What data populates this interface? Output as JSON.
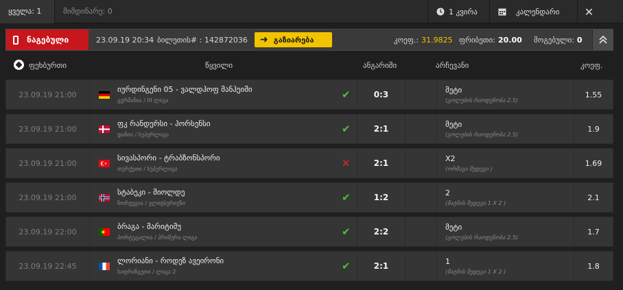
{
  "tabs": {
    "all_label": "ყველა: 1",
    "selected_label": "მიმდინარე: 0"
  },
  "top_actions": {
    "week_label": "1 კვირა",
    "calendar_label": "კალენდარი",
    "close_symbol": "✕"
  },
  "ticket": {
    "saved_label": "ნაგებული",
    "datetime": "23.09.19 20:34",
    "ticket_label": "ბილეთის# : 142872036",
    "share_label": "გაზიარება",
    "coef_label": "კოეფ.:",
    "coef_value": "31.9825",
    "freebet_label": "ფრიბეთი:",
    "freebet_value": "20.00",
    "winnings_label": "მოგებული:",
    "winnings_value": "0"
  },
  "table_header": {
    "sport": "ფეხბურთი",
    "event": "წყვილი",
    "score": "ანგარიში",
    "pick": "არჩევანი",
    "odds": "კოეფ."
  },
  "colors": {
    "accent": "#f2c300",
    "saved_red": "#c8161d",
    "win": "#4fbf3a",
    "lose": "#e12525"
  },
  "rows": [
    {
      "date": "23.09.19 21:00",
      "flag": "germany",
      "name": "იურდინგენი 05 - ვალდჰოფ მანჰეიმი",
      "league": "გერმანია / III ლიგა",
      "status": "win",
      "score": "0:3",
      "pick": "მეტი",
      "pick_sub": "(გოლების რაოდენობა 2.5)",
      "odds": "1.55"
    },
    {
      "date": "23.09.19 21:00",
      "flag": "denmark",
      "name": "ფკ რანდერსი - ჰორსენსი",
      "league": "დანია / სუპერლიგა",
      "status": "win",
      "score": "2:1",
      "pick": "მეტი",
      "pick_sub": "(გოლების რაოდენობა 2.5)",
      "odds": "1.9"
    },
    {
      "date": "23.09.19 21:00",
      "flag": "turkey",
      "name": "სივასპორი - ტრაბზონსპორი",
      "league": "თურქეთი / სუპერლიგა",
      "status": "lose",
      "score": "2:1",
      "pick": "X2",
      "pick_sub": "(ორმაგი შედეგი )",
      "odds": "1.69"
    },
    {
      "date": "23.09.19 21:00",
      "flag": "norway",
      "name": "სტაბეკი - მიოლდე",
      "league": "ნორვეგია / ელიტსერიენი",
      "status": "win",
      "score": "1:2",
      "pick": "2",
      "pick_sub": "(მატჩის შედეგი 1 X 2 )",
      "odds": "2.1"
    },
    {
      "date": "23.09.19 22:00",
      "flag": "portugal",
      "name": "ბრაგა - მარიტიმუ",
      "league": "პორტუგალია / პრიმერა ლიგა",
      "status": "win",
      "score": "2:2",
      "pick": "მეტი",
      "pick_sub": "(გოლების რაოდენობა 2.5)",
      "odds": "1.7"
    },
    {
      "date": "23.09.19 22:45",
      "flag": "france",
      "name": "ლორიანი - როდეზ ავეირონი",
      "league": "საფრანგეთი / ლიგა 2",
      "status": "win",
      "score": "2:1",
      "pick": "1",
      "pick_sub": "(მატჩის შედეგი 1 X 2 )",
      "odds": "1.8"
    }
  ]
}
